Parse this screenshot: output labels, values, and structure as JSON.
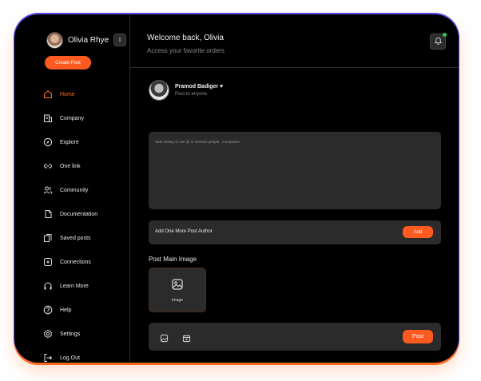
{
  "sidebar": {
    "profile_name": "Olivia Rhye",
    "create_post_label": "Create Post",
    "items": [
      {
        "label": "Home",
        "icon": "home-icon",
        "active": true
      },
      {
        "label": "Company",
        "icon": "company-icon"
      },
      {
        "label": "Explore",
        "icon": "compass-icon"
      },
      {
        "label": "One link",
        "icon": "link-icon"
      },
      {
        "label": "Community",
        "icon": "users-icon"
      },
      {
        "label": "Documentation",
        "icon": "document-icon"
      },
      {
        "label": "Saved posts",
        "icon": "bookmark-icon"
      },
      {
        "label": "Connections",
        "icon": "connections-icon"
      },
      {
        "label": "Learn More",
        "icon": "headphones-icon"
      },
      {
        "label": "Help",
        "icon": "help-icon"
      },
      {
        "label": "Settings",
        "icon": "gear-icon"
      },
      {
        "label": "Log Out",
        "icon": "logout-icon"
      }
    ]
  },
  "header": {
    "welcome": "Welcome back, Olivia",
    "subtitle": "Access your favorite orders"
  },
  "composer": {
    "author_name": "Pramod Badiger",
    "author_sub": "Post to anyone",
    "placeholder": "Start writing or use @ to mention people , companies",
    "add_author_label": "Add One More Post Author",
    "add_button": "Add",
    "image_section_title": "Post Main Image",
    "image_label": "Image",
    "post_button": "Post"
  },
  "colors": {
    "accent": "#ff5a1f",
    "background": "#000000",
    "panel": "#2b2b2b",
    "online": "#2ec44f"
  }
}
